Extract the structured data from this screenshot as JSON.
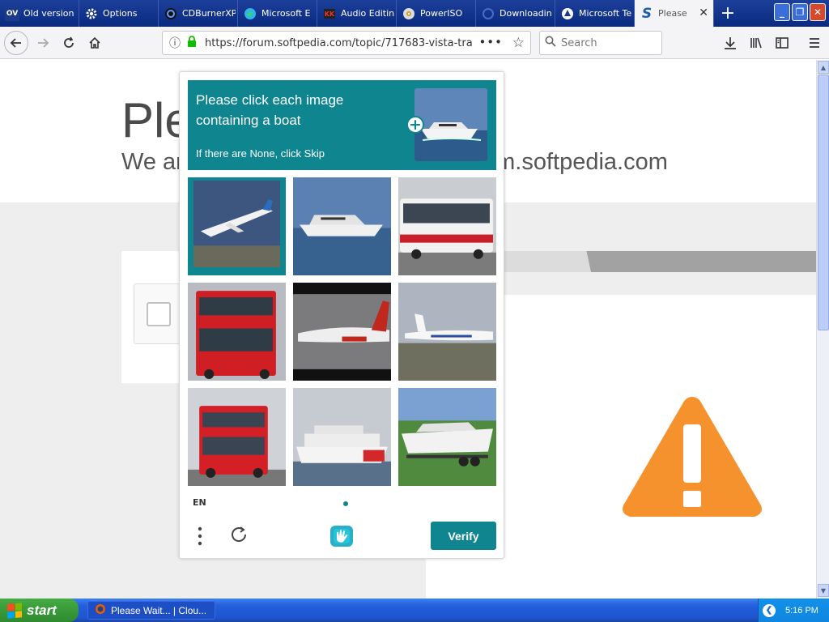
{
  "tabs": [
    {
      "label": "Old version",
      "icon": "ov-icon",
      "fav_text": "OV"
    },
    {
      "label": "Options",
      "icon": "gear-icon"
    },
    {
      "label": "CDBurnerXP",
      "icon": "disc-icon"
    },
    {
      "label": "Microsoft E",
      "icon": "edge-icon"
    },
    {
      "label": "Audio Editin",
      "icon": "audio-icon"
    },
    {
      "label": "PowerISO",
      "icon": "cd-icon"
    },
    {
      "label": "Downloadin",
      "icon": "loading-icon"
    },
    {
      "label": "Microsoft Te",
      "icon": "teams-icon"
    },
    {
      "label": "Please",
      "icon": "softpedia-icon",
      "fav_text": "S",
      "active": true
    }
  ],
  "url": "https://forum.softpedia.com/topic/717683-vista-transf",
  "search_placeholder": "Search",
  "page": {
    "heading": "Ple",
    "subheading_left": "We ar",
    "subheading_right": "um.softpedia.com"
  },
  "captcha": {
    "prompt": "Please click each image containing a boat",
    "skip_hint": "If there are None, click Skip",
    "language": "EN",
    "verify_label": "Verify",
    "tiles": [
      {
        "subject": "airplane",
        "selected": true
      },
      {
        "subject": "boat",
        "selected": false
      },
      {
        "subject": "bus",
        "selected": false
      },
      {
        "subject": "double-decker-bus",
        "selected": false
      },
      {
        "subject": "airplane",
        "selected": false
      },
      {
        "subject": "jet",
        "selected": false
      },
      {
        "subject": "double-decker-bus",
        "selected": false
      },
      {
        "subject": "cruise-ship",
        "selected": false
      },
      {
        "subject": "boat-on-trailer",
        "selected": false
      }
    ]
  },
  "taskbar": {
    "start_label": "start",
    "item_label": "Please Wait... | Clou...",
    "clock": "5:16 PM"
  },
  "colors": {
    "accent": "#0f8590",
    "warning": "#f5922e",
    "taskbar": "#245edb",
    "start": "#3a9d3a"
  }
}
